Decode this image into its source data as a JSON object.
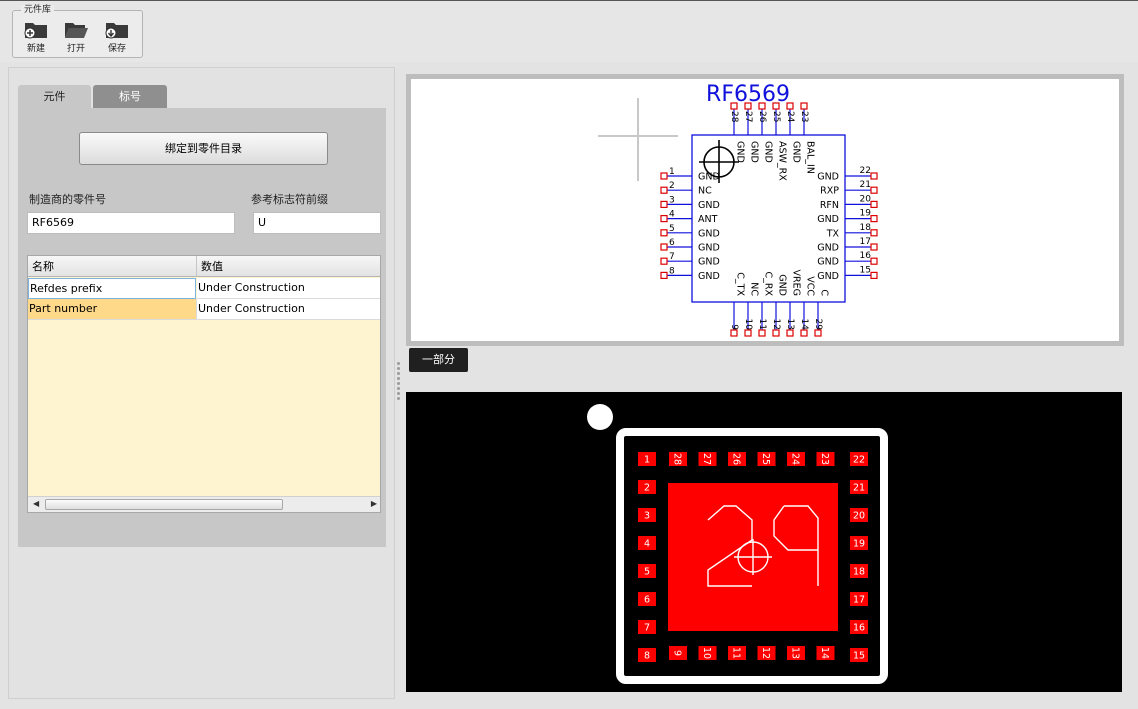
{
  "ribbon": {
    "group_title": "元件库",
    "buttons": [
      {
        "id": "new",
        "label": "新建",
        "icon": "folder-add-icon"
      },
      {
        "id": "open",
        "label": "打开",
        "icon": "folder-open-icon"
      },
      {
        "id": "save",
        "label": "保存",
        "icon": "folder-save-icon"
      }
    ]
  },
  "left": {
    "tabs": [
      {
        "label": "元件"
      },
      {
        "label": "标号"
      }
    ],
    "bind_button": "绑定到零件目录",
    "mfr_part_label": "制造商的零件号",
    "mfr_part_value": "RF6569",
    "refdes_label": "参考标志符前缀",
    "refdes_value": "U",
    "grid": {
      "columns": [
        "名称",
        "数值"
      ],
      "rows": [
        {
          "name": "Refdes prefix",
          "value": "Under Construction"
        },
        {
          "name": "Part number",
          "value": "Under Construction"
        }
      ]
    }
  },
  "schematic": {
    "title": "RF6569",
    "left_pins": [
      {
        "num": "1",
        "name": "GND"
      },
      {
        "num": "2",
        "name": "NC"
      },
      {
        "num": "3",
        "name": "GND"
      },
      {
        "num": "4",
        "name": "ANT"
      },
      {
        "num": "5",
        "name": "GND"
      },
      {
        "num": "6",
        "name": "GND"
      },
      {
        "num": "7",
        "name": "GND"
      },
      {
        "num": "8",
        "name": "GND"
      }
    ],
    "right_pins": [
      {
        "num": "22",
        "name": "GND"
      },
      {
        "num": "21",
        "name": "RXP"
      },
      {
        "num": "20",
        "name": "RFN"
      },
      {
        "num": "19",
        "name": "GND"
      },
      {
        "num": "18",
        "name": "TX"
      },
      {
        "num": "17",
        "name": "GND"
      },
      {
        "num": "16",
        "name": "GND"
      },
      {
        "num": "15",
        "name": "GND"
      }
    ],
    "top_pins": [
      {
        "num": "28",
        "name": "GND"
      },
      {
        "num": "27",
        "name": "GND"
      },
      {
        "num": "26",
        "name": "GND"
      },
      {
        "num": "25",
        "name": "ASW_RX"
      },
      {
        "num": "24",
        "name": "GND"
      },
      {
        "num": "23",
        "name": "BAL_IN"
      }
    ],
    "bottom_pins": [
      {
        "num": "9",
        "name": "C_TX"
      },
      {
        "num": "10",
        "name": "NC"
      },
      {
        "num": "11",
        "name": "C_RX"
      },
      {
        "num": "12",
        "name": "GND"
      },
      {
        "num": "13",
        "name": "VREG"
      },
      {
        "num": "14",
        "name": "VCC"
      },
      {
        "num": "29",
        "name": "C"
      }
    ]
  },
  "section_button": "一部分",
  "footprint": {
    "left_pads": [
      "1",
      "2",
      "3",
      "4",
      "5",
      "6",
      "7",
      "8"
    ],
    "right_pads": [
      "22",
      "21",
      "20",
      "19",
      "18",
      "17",
      "16",
      "15"
    ],
    "top_pads": [
      "28",
      "27",
      "26",
      "25",
      "24",
      "23"
    ],
    "bottom_pads": [
      "9",
      "10",
      "11",
      "12",
      "13",
      "14"
    ],
    "center_pad": "29"
  },
  "colors": {
    "schematic_blue": "#1010dd",
    "pin_red": "#dd0000",
    "pad_red": "#ff0000"
  }
}
